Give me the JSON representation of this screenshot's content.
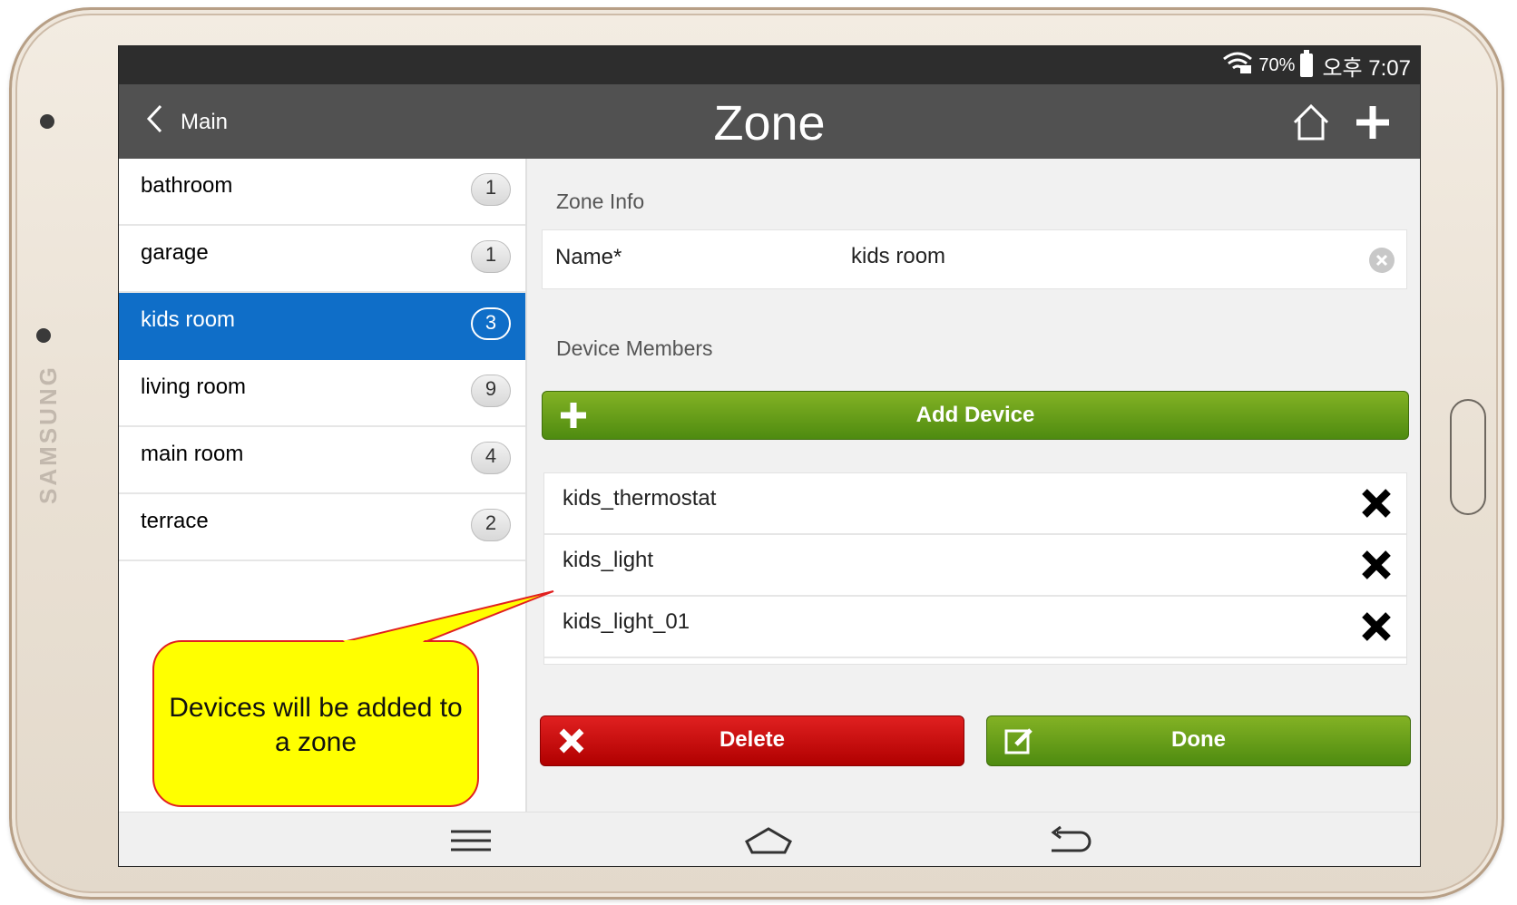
{
  "device": {
    "brand": "SAMSUNG"
  },
  "status_bar": {
    "battery_pct": "70%",
    "time": "오후 7:07"
  },
  "app_bar": {
    "back_label": "Main",
    "title": "Zone"
  },
  "zones": [
    {
      "name": "bathroom",
      "count": "1"
    },
    {
      "name": "garage",
      "count": "1"
    },
    {
      "name": "kids room",
      "count": "3",
      "selected": true
    },
    {
      "name": "living room",
      "count": "9"
    },
    {
      "name": "main room",
      "count": "4"
    },
    {
      "name": "terrace",
      "count": "2"
    }
  ],
  "detail": {
    "zone_info_label": "Zone Info",
    "name_label": "Name*",
    "name_value": "kids room",
    "device_members_label": "Device Members",
    "add_device_label": "Add Device",
    "members": [
      "kids_thermostat",
      "kids_light",
      "kids_light_01"
    ],
    "delete_label": "Delete",
    "done_label": "Done"
  },
  "callout": {
    "text": "Devices will be added to a zone"
  },
  "colors": {
    "selected_zone": "#0f6ec8",
    "add_button": "#6ba11a",
    "delete_button": "#c80000",
    "callout_fill": "#ffff00",
    "callout_border": "#e12020"
  },
  "icons": [
    "wifi-icon",
    "battery-icon",
    "back-chevron-icon",
    "home-icon",
    "add-icon",
    "clear-icon",
    "plus-icon",
    "close-x-icon",
    "edit-icon",
    "menu-icon",
    "nav-home-icon",
    "nav-back-icon"
  ]
}
